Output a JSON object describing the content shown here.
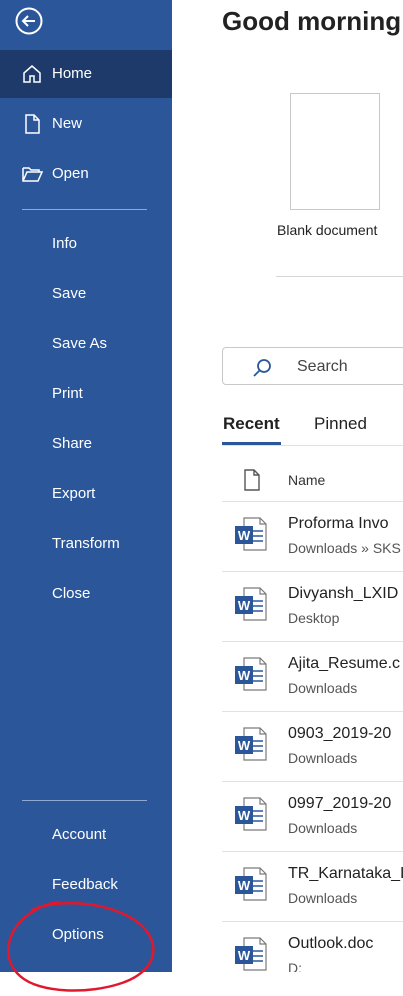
{
  "sidebar": {
    "items": [
      {
        "label": "Home",
        "icon": "home-icon"
      },
      {
        "label": "New",
        "icon": "new-document-icon"
      },
      {
        "label": "Open",
        "icon": "folder-open-icon"
      },
      {
        "label": "Info"
      },
      {
        "label": "Save"
      },
      {
        "label": "Save As"
      },
      {
        "label": "Print"
      },
      {
        "label": "Share"
      },
      {
        "label": "Export"
      },
      {
        "label": "Transform"
      },
      {
        "label": "Close"
      },
      {
        "label": "Account"
      },
      {
        "label": "Feedback"
      },
      {
        "label": "Options"
      }
    ],
    "color": "#2b579a",
    "active_color": "#1d3a6b"
  },
  "header": {
    "greeting": "Good morning"
  },
  "templates": [
    {
      "label": "Blank document"
    }
  ],
  "search": {
    "placeholder": "Search"
  },
  "tabs": [
    {
      "label": "Recent"
    },
    {
      "label": "Pinned"
    }
  ],
  "list": {
    "column_name": "Name",
    "rows": [
      {
        "name": "Proforma Invo",
        "path": "Downloads » SKS"
      },
      {
        "name": "Divyansh_LXID",
        "path": "Desktop"
      },
      {
        "name": "Ajita_Resume.c",
        "path": "Downloads"
      },
      {
        "name": "0903_2019-20",
        "path": "Downloads"
      },
      {
        "name": "0997_2019-20",
        "path": "Downloads"
      },
      {
        "name": "TR_Karnataka_L",
        "path": "Downloads"
      },
      {
        "name": "Outlook.doc",
        "path": "D:"
      }
    ]
  },
  "annotation": {
    "color": "#e0182d"
  }
}
